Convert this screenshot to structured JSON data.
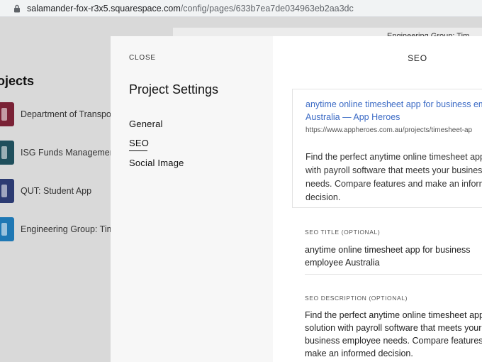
{
  "browser": {
    "url_domain": "salamander-fox-r3x5.squarespace.com",
    "url_path": "/config/pages/633b7ea7de034963eb2aa3dc"
  },
  "background": {
    "title": "ojects",
    "top_card_text": "Engineering Group: Tim",
    "items": [
      {
        "label": "Department of Transpor",
        "color": "#7a2236"
      },
      {
        "label": "ISG Funds Management",
        "color": "#1f4f5c"
      },
      {
        "label": "QUT: Student App",
        "color": "#2c3b72"
      },
      {
        "label": "Engineering Group: Tim",
        "color": "#1f78b4"
      }
    ]
  },
  "modal": {
    "close_label": "CLOSE",
    "title": "Project Settings",
    "nav": [
      {
        "label": "General"
      },
      {
        "label": "SEO"
      },
      {
        "label": "Social Image"
      }
    ],
    "section_title": "SEO",
    "preview": {
      "title_line1": "anytime online timesheet app for business emp",
      "title_line2": "Australia — App Heroes",
      "url": "https://www.appheroes.com.au/projects/timesheet-ap",
      "desc_lines": [
        "Find the perfect anytime online timesheet app s",
        "with payroll software that meets your business e",
        "needs. Compare features and make an informed",
        "decision."
      ]
    },
    "seo_title_label": "SEO TITLE (OPTIONAL)",
    "seo_title_lines": [
      "anytime online timesheet app for business",
      "employee Australia"
    ],
    "seo_desc_label": "SEO DESCRIPTION (OPTIONAL)",
    "seo_desc_lines": [
      "Find the perfect anytime online timesheet app",
      "solution with payroll software that meets your",
      "business employee needs. Compare features a",
      "make an informed decision."
    ]
  }
}
